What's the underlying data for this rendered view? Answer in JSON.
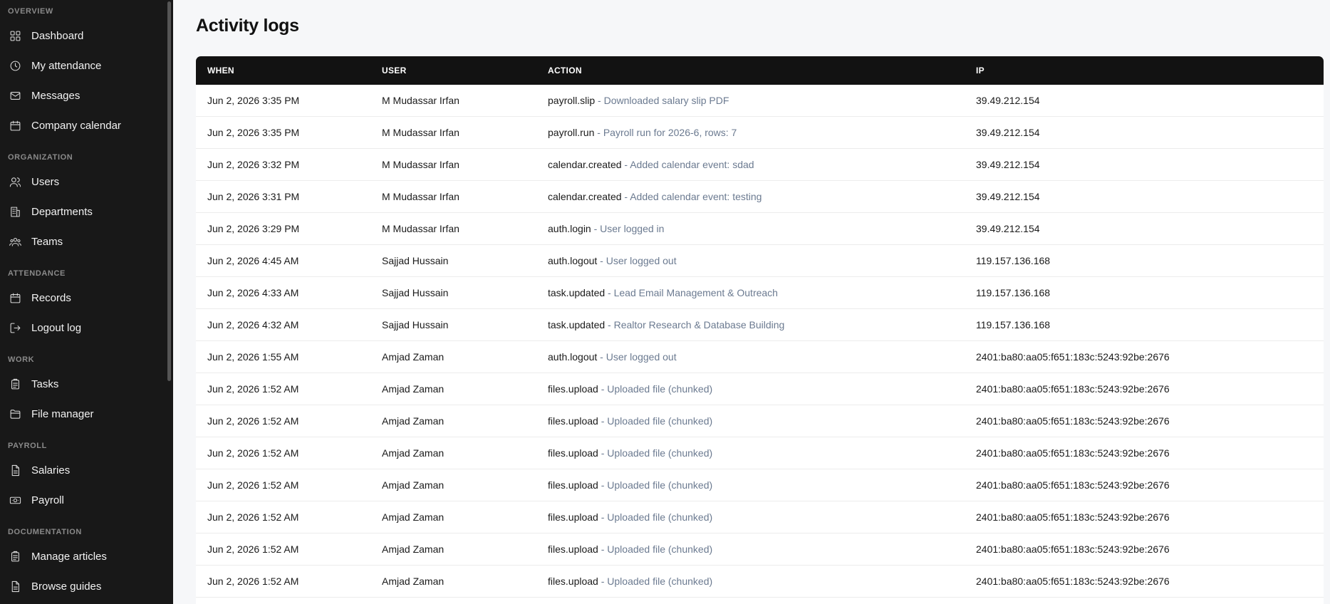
{
  "sidebar": {
    "sections": [
      {
        "label": "OVERVIEW",
        "items": [
          {
            "label": "Dashboard",
            "icon": "grid-icon"
          },
          {
            "label": "My attendance",
            "icon": "clock-icon"
          },
          {
            "label": "Messages",
            "icon": "mail-icon"
          },
          {
            "label": "Company calendar",
            "icon": "calendar-icon"
          }
        ]
      },
      {
        "label": "ORGANIZATION",
        "items": [
          {
            "label": "Users",
            "icon": "users-icon"
          },
          {
            "label": "Departments",
            "icon": "building-icon"
          },
          {
            "label": "Teams",
            "icon": "team-icon"
          }
        ]
      },
      {
        "label": "ATTENDANCE",
        "items": [
          {
            "label": "Records",
            "icon": "calendar-icon"
          },
          {
            "label": "Logout log",
            "icon": "logout-icon"
          }
        ]
      },
      {
        "label": "WORK",
        "items": [
          {
            "label": "Tasks",
            "icon": "clipboard-icon"
          },
          {
            "label": "File manager",
            "icon": "folder-icon"
          }
        ]
      },
      {
        "label": "PAYROLL",
        "items": [
          {
            "label": "Salaries",
            "icon": "document-icon"
          },
          {
            "label": "Payroll",
            "icon": "cash-icon"
          }
        ]
      },
      {
        "label": "DOCUMENTATION",
        "items": [
          {
            "label": "Manage articles",
            "icon": "clipboard-icon"
          },
          {
            "label": "Browse guides",
            "icon": "document-icon"
          }
        ]
      }
    ]
  },
  "main": {
    "title": "Activity logs",
    "table": {
      "headers": {
        "when": "WHEN",
        "user": "USER",
        "action": "ACTION",
        "ip": "IP"
      },
      "rows": [
        {
          "when": "Jun 2, 2026 3:35 PM",
          "user": "M Mudassar Irfan",
          "code": "payroll.slip",
          "desc": " - Downloaded salary slip PDF",
          "ip": "39.49.212.154"
        },
        {
          "when": "Jun 2, 2026 3:35 PM",
          "user": "M Mudassar Irfan",
          "code": "payroll.run",
          "desc": " - Payroll run for 2026-6, rows: 7",
          "ip": "39.49.212.154"
        },
        {
          "when": "Jun 2, 2026 3:32 PM",
          "user": "M Mudassar Irfan",
          "code": "calendar.created",
          "desc": " - Added calendar event: sdad",
          "ip": "39.49.212.154"
        },
        {
          "when": "Jun 2, 2026 3:31 PM",
          "user": "M Mudassar Irfan",
          "code": "calendar.created",
          "desc": " - Added calendar event: testing",
          "ip": "39.49.212.154"
        },
        {
          "when": "Jun 2, 2026 3:29 PM",
          "user": "M Mudassar Irfan",
          "code": "auth.login",
          "desc": " - User logged in",
          "ip": "39.49.212.154"
        },
        {
          "when": "Jun 2, 2026 4:45 AM",
          "user": "Sajjad Hussain",
          "code": "auth.logout",
          "desc": " - User logged out",
          "ip": "119.157.136.168"
        },
        {
          "when": "Jun 2, 2026 4:33 AM",
          "user": "Sajjad Hussain",
          "code": "task.updated",
          "desc": " - Lead Email Management & Outreach",
          "ip": "119.157.136.168"
        },
        {
          "when": "Jun 2, 2026 4:32 AM",
          "user": "Sajjad Hussain",
          "code": "task.updated",
          "desc": " - Realtor Research & Database Building",
          "ip": "119.157.136.168"
        },
        {
          "when": "Jun 2, 2026 1:55 AM",
          "user": "Amjad Zaman",
          "code": "auth.logout",
          "desc": " - User logged out",
          "ip": "2401:ba80:aa05:f651:183c:5243:92be:2676"
        },
        {
          "when": "Jun 2, 2026 1:52 AM",
          "user": "Amjad Zaman",
          "code": "files.upload",
          "desc": " - Uploaded file (chunked)",
          "ip": "2401:ba80:aa05:f651:183c:5243:92be:2676"
        },
        {
          "when": "Jun 2, 2026 1:52 AM",
          "user": "Amjad Zaman",
          "code": "files.upload",
          "desc": " - Uploaded file (chunked)",
          "ip": "2401:ba80:aa05:f651:183c:5243:92be:2676"
        },
        {
          "when": "Jun 2, 2026 1:52 AM",
          "user": "Amjad Zaman",
          "code": "files.upload",
          "desc": " - Uploaded file (chunked)",
          "ip": "2401:ba80:aa05:f651:183c:5243:92be:2676"
        },
        {
          "when": "Jun 2, 2026 1:52 AM",
          "user": "Amjad Zaman",
          "code": "files.upload",
          "desc": " - Uploaded file (chunked)",
          "ip": "2401:ba80:aa05:f651:183c:5243:92be:2676"
        },
        {
          "when": "Jun 2, 2026 1:52 AM",
          "user": "Amjad Zaman",
          "code": "files.upload",
          "desc": " - Uploaded file (chunked)",
          "ip": "2401:ba80:aa05:f651:183c:5243:92be:2676"
        },
        {
          "when": "Jun 2, 2026 1:52 AM",
          "user": "Amjad Zaman",
          "code": "files.upload",
          "desc": " - Uploaded file (chunked)",
          "ip": "2401:ba80:aa05:f651:183c:5243:92be:2676"
        },
        {
          "when": "Jun 2, 2026 1:52 AM",
          "user": "Amjad Zaman",
          "code": "files.upload",
          "desc": " - Uploaded file (chunked)",
          "ip": "2401:ba80:aa05:f651:183c:5243:92be:2676"
        }
      ]
    }
  }
}
